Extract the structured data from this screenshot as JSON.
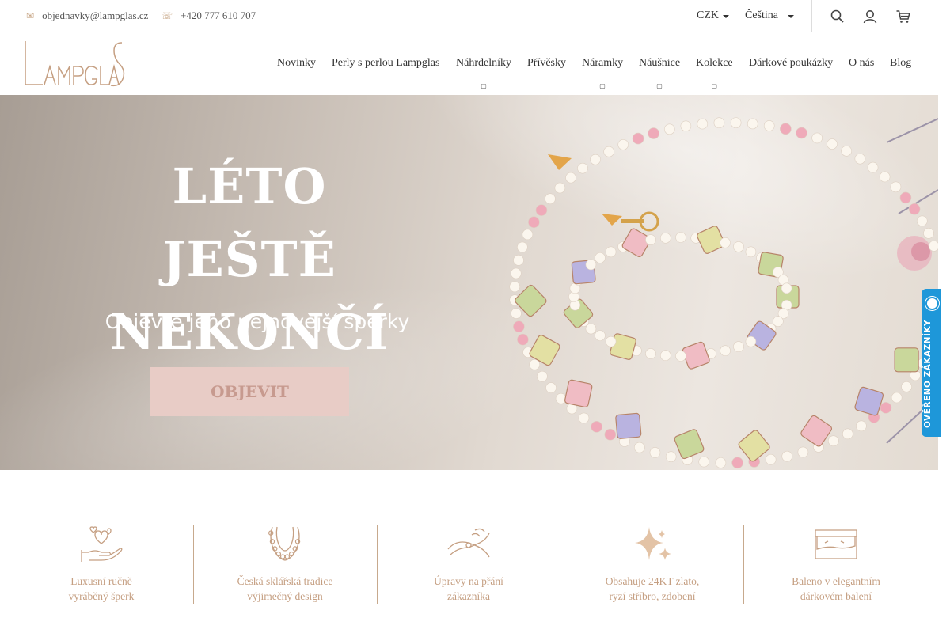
{
  "topbar": {
    "email": "objednavky@lampglas.cz",
    "phone": "+420 777 610 707",
    "currency": "CZK",
    "language": "Čeština"
  },
  "icons": {
    "email": "envelope-icon",
    "phone": "phone-icon",
    "search": "search-icon",
    "account": "user-icon",
    "cart": "cart-icon"
  },
  "logo_text": "LAMPGLAS",
  "nav": {
    "items": [
      {
        "label": "Novinky",
        "has_sub": false
      },
      {
        "label": "Perly s perlou Lampglas",
        "has_sub": false
      },
      {
        "label": "Náhrdelníky",
        "has_sub": true
      },
      {
        "label": "Přívěsky",
        "has_sub": false
      },
      {
        "label": "Náramky",
        "has_sub": true
      },
      {
        "label": "Náušnice",
        "has_sub": true
      },
      {
        "label": "Kolekce",
        "has_sub": true
      },
      {
        "label": "Dárkové poukázky",
        "has_sub": false
      },
      {
        "label": "O nás",
        "has_sub": false
      },
      {
        "label": "Blog",
        "has_sub": false
      }
    ]
  },
  "hero": {
    "title_line1": "LÉTO JEŠTĚ",
    "title_line2": "NEKONČÍ",
    "subtitle": "Objevte jeho nejnovější šperky",
    "button": "OBJEVIT"
  },
  "badge": {
    "text": "OVĚŘENO ZÁKAZNÍKY"
  },
  "features": [
    {
      "icon": "hand-hearts-icon",
      "line1": "Luxusní ručně",
      "line2": "vyráběný šperk"
    },
    {
      "icon": "necklace-icon",
      "line1": "Česká sklářská tradice",
      "line2": "výjimečný design"
    },
    {
      "icon": "pliers-icon",
      "line1": "Úpravy na přání",
      "line2": "zákazníka"
    },
    {
      "icon": "sparkle-icon",
      "line1": "Obsahuje 24KT zlato,",
      "line2": "ryzí stříbro, zdobení"
    },
    {
      "icon": "gift-box-icon",
      "line1": "Baleno v elegantním",
      "line2": "dárkovém balení"
    }
  ],
  "colors": {
    "accent_gold": "#c59f82",
    "button_bg": "#e8ccc6",
    "button_text": "#c79a8f",
    "badge_blue": "#1e97d9"
  }
}
